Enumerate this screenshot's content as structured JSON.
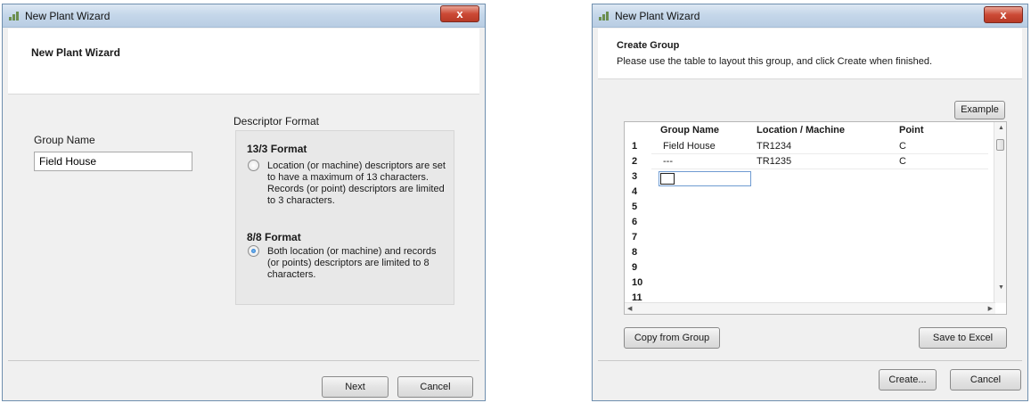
{
  "wizard1": {
    "window_title": "New Plant Wizard",
    "close_glyph": "x",
    "header_title": "New Plant Wizard",
    "group_name_label": "Group Name",
    "group_name_value": "Field House",
    "descriptor_format_label": "Descriptor Format",
    "option_13_3": {
      "title": "13/3 Format",
      "description": "Location (or machine) descriptors are set to have a maximum of 13 characters.  Records (or point) descriptors are limited  to 3 characters.",
      "selected": false
    },
    "option_8_8": {
      "title": "8/8 Format",
      "description": "Both location (or machine) and records (or points) descriptors are limited to 8 characters.",
      "selected": true
    },
    "buttons": {
      "next": "Next",
      "cancel": "Cancel"
    }
  },
  "wizard2": {
    "window_title": "New Plant Wizard",
    "close_glyph": "x",
    "header_title": "Create Group",
    "header_subtitle": "Please use the table to layout this group, and click Create when finished.",
    "example_button": "Example",
    "table": {
      "columns": [
        "Group Name",
        "Location / Machine",
        "Point"
      ],
      "row_numbers": [
        "1",
        "2",
        "3",
        "4",
        "5",
        "6",
        "7",
        "8",
        "9",
        "10",
        "11"
      ],
      "rows": [
        [
          "Field House",
          "TR1234",
          "C"
        ],
        [
          "---",
          "TR1235",
          "C"
        ]
      ],
      "active_row": "3"
    },
    "buttons": {
      "copy_from_group": "Copy from Group",
      "save_to_excel": "Save to Excel",
      "create": "Create...",
      "cancel": "Cancel"
    }
  },
  "icons": [
    "app-icon",
    "close-icon",
    "radio-icon",
    "scroll-arrow-icon"
  ]
}
